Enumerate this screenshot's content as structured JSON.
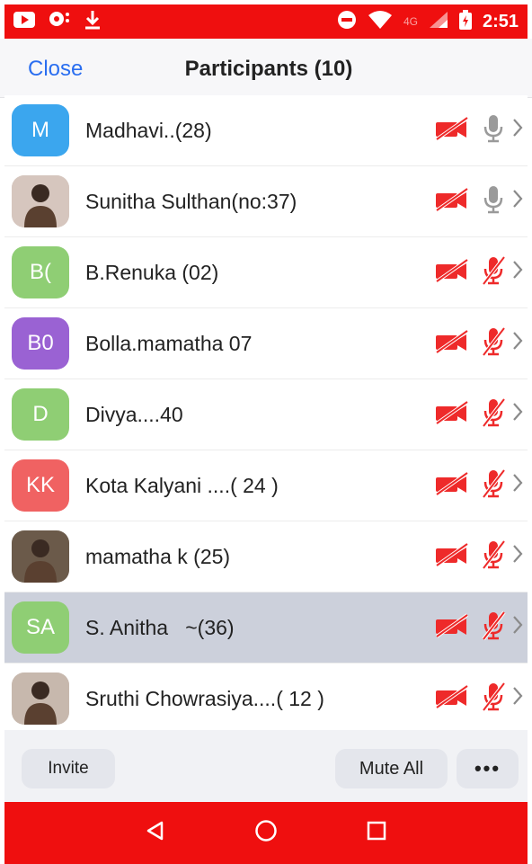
{
  "status_bar": {
    "time": "2:51",
    "network": "4G",
    "icons": [
      "youtube-icon",
      "chat-icon",
      "download-icon",
      "do-not-disturb-icon",
      "wifi-icon",
      "signal-icon",
      "battery-icon"
    ]
  },
  "header": {
    "close_label": "Close",
    "title": "Participants (10)"
  },
  "participants": [
    {
      "name": "Madhavi..(28)",
      "initials": "M",
      "avatar_color": "#3ba6ee",
      "avatar_type": "initials",
      "video": "off",
      "audio": "unmuted",
      "selected": false
    },
    {
      "name": "Sunitha Sulthan(no:37)",
      "initials": "",
      "avatar_color": "#d6c6be",
      "avatar_type": "photo",
      "video": "off",
      "audio": "unmuted",
      "selected": false
    },
    {
      "name": "B.Renuka (02)",
      "initials": "B(",
      "avatar_color": "#8fce74",
      "avatar_type": "initials",
      "video": "off",
      "audio": "muted",
      "selected": false
    },
    {
      "name": "Bolla.mamatha 07",
      "initials": "B0",
      "avatar_color": "#9a62d3",
      "avatar_type": "initials",
      "video": "off",
      "audio": "muted",
      "selected": false
    },
    {
      "name": "Divya....40",
      "initials": "D",
      "avatar_color": "#8fce74",
      "avatar_type": "initials",
      "video": "off",
      "audio": "muted",
      "selected": false
    },
    {
      "name": "Kota Kalyani ....( 24 )",
      "initials": "KK",
      "avatar_color": "#f06262",
      "avatar_type": "initials",
      "video": "off",
      "audio": "muted",
      "selected": false
    },
    {
      "name": "mamatha k (25)",
      "initials": "",
      "avatar_color": "#6b5a4a",
      "avatar_type": "photo",
      "video": "off",
      "audio": "muted",
      "selected": false
    },
    {
      "name": "S. Anitha   ~(36)",
      "initials": "SA",
      "avatar_color": "#8fce74",
      "avatar_type": "initials",
      "video": "off",
      "audio": "muted",
      "selected": true
    },
    {
      "name": "Sruthi Chowrasiya....( 12 )",
      "initials": "",
      "avatar_color": "#c7b8ad",
      "avatar_type": "photo",
      "video": "off",
      "audio": "muted",
      "selected": false
    }
  ],
  "footer": {
    "invite_label": "Invite",
    "mute_all_label": "Mute All",
    "more_label": "•••"
  },
  "nav_bar": {
    "buttons": [
      "back-icon",
      "home-icon",
      "recents-icon"
    ]
  },
  "colors": {
    "status_bar_bg": "#ef0f0f",
    "accent_blue": "#2a6ef0",
    "muted_red": "#ee2a2a",
    "unmuted_gray": "#9a9a9a",
    "selected_row_bg": "#ccd0db"
  }
}
